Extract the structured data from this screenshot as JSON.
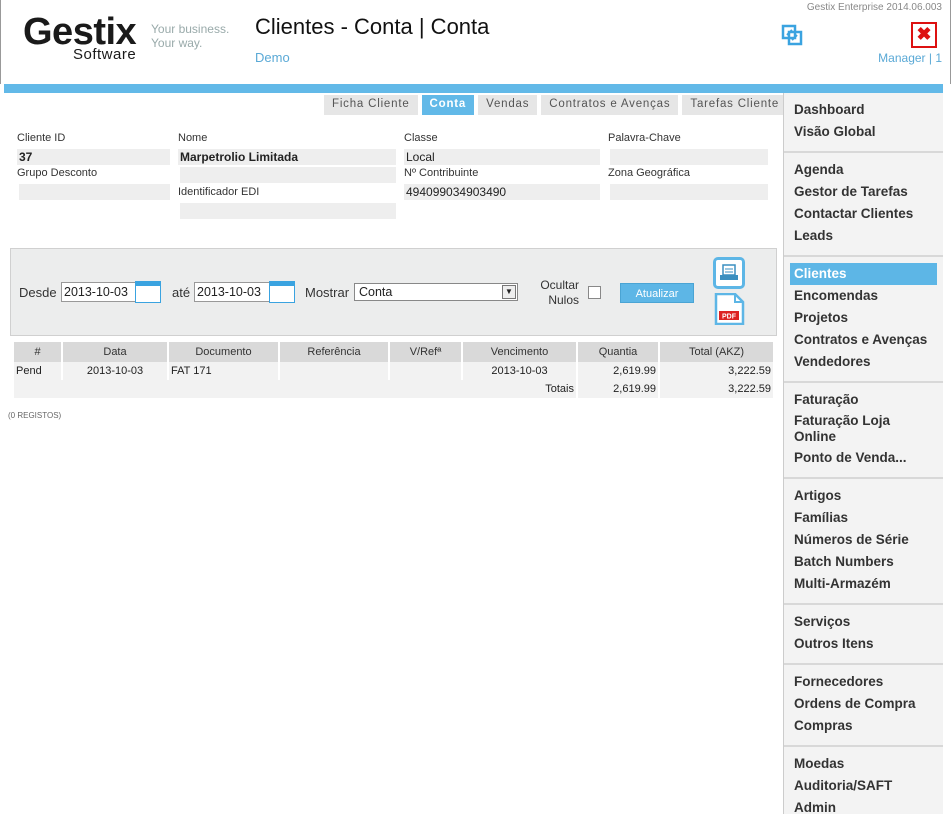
{
  "header": {
    "logo_main": "Gestix",
    "logo_sub": "Software",
    "slogan_1": "Your business.",
    "slogan_2": "Your way.",
    "title": "Clientes - Conta | Conta",
    "company": "Demo",
    "version": "Gestix Enterprise 2014.06.003",
    "user": "Manager | 1",
    "close_icon_glyph": "✖"
  },
  "tabs": [
    {
      "label": "Ficha Cliente",
      "active": false
    },
    {
      "label": "Conta",
      "active": true
    },
    {
      "label": "Vendas",
      "active": false
    },
    {
      "label": "Contratos e Avenças",
      "active": false
    },
    {
      "label": "Tarefas Cliente",
      "active": false
    }
  ],
  "form": {
    "cliente_id_label": "Cliente ID",
    "cliente_id": "37",
    "nome_label": "Nome",
    "nome": "Marpetrolio Limitada",
    "classe_label": "Classe",
    "classe": "Local",
    "palavra_chave_label": "Palavra-Chave",
    "palavra_chave": "",
    "grupo_desconto_label": "Grupo Desconto",
    "grupo_desconto": "",
    "contribuinte_label": "Nº Contribuinte",
    "contribuinte": "494099034903490",
    "zona_label": "Zona Geográfica",
    "zona": "",
    "edi_label": "Identificador EDI",
    "edi": ""
  },
  "filter": {
    "desde_label": "Desde",
    "desde_value": "2013-10-03",
    "ate_label": "até",
    "ate_value": "2013-10-03",
    "mostrar_label": "Mostrar",
    "mostrar_value": "Conta",
    "ocultar_label_1": "Ocultar",
    "ocultar_label_2": "Nulos",
    "ocultar_checked": false,
    "update_label": "Atualizar",
    "pdf_label": "PDF"
  },
  "table": {
    "headers": [
      "#",
      "Data",
      "Documento",
      "Referência",
      "V/Refª",
      "Vencimento",
      "Quantia",
      "Total (AKZ)"
    ],
    "rows": [
      [
        "Pend",
        "2013-10-03",
        "FAT  171",
        "",
        "",
        "2013-10-03",
        "2,619.99",
        "3,222.59"
      ]
    ],
    "totals_label": "Totais",
    "totals_quantia": "2,619.99",
    "totals_total": "3,222.59",
    "record_count": "(0 REGISTOS)"
  },
  "sidebar": {
    "groups": [
      [
        "Dashboard",
        "Visão Global"
      ],
      [
        "Agenda",
        "Gestor de Tarefas",
        "Contactar Clientes",
        "Leads"
      ],
      [
        "Clientes",
        "Encomendas",
        "Projetos",
        "Contratos e Avenças",
        "Vendedores"
      ],
      [
        "Faturação",
        "Faturação Loja Online",
        "Ponto de Venda..."
      ],
      [
        "Artigos",
        "Famílias",
        "Números de Série",
        "Batch Numbers",
        "Multi-Armazém"
      ],
      [
        "Serviços",
        "Outros Itens"
      ],
      [
        "Fornecedores",
        "Ordens de Compra",
        "Compras"
      ],
      [
        "Moedas",
        "Auditoria/SAFT",
        "Admin"
      ]
    ],
    "active_item": "Clientes"
  },
  "colors": {
    "accent": "#62b9e8",
    "close": "#dd1111",
    "field_bg": "#eeeeee"
  }
}
